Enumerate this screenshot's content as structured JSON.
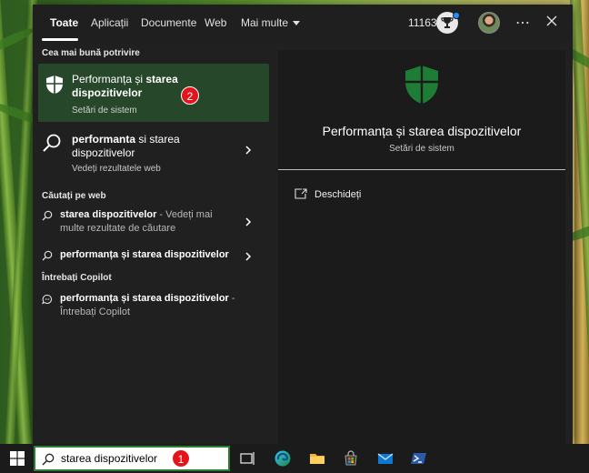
{
  "tabs": [
    {
      "label": "Toate"
    },
    {
      "label": "Aplicații"
    },
    {
      "label": "Documente"
    },
    {
      "label": "Web"
    },
    {
      "label": "Mai multe"
    }
  ],
  "topbar": {
    "points": "11163"
  },
  "left": {
    "best_match_header": "Cea mai bună potrivire",
    "best_match": {
      "title_a": "Performanța și ",
      "title_b": "starea dispozitivelor",
      "subtitle": "Setări de sistem",
      "badge": "2"
    },
    "web_result": {
      "title_a": "performanta",
      "title_b": " si starea dispozitivelor",
      "subtitle": "Vedeți rezultatele web"
    },
    "web_header": "Căutați pe web",
    "web_items": [
      {
        "bold": "starea dispozitivelor",
        "rest": " - Vedeți mai multe rezultate de căutare"
      },
      {
        "bold": "performanța și starea dispozitivelor",
        "rest": ""
      }
    ],
    "copilot_header": "Întrebați Copilot",
    "copilot_item": {
      "bold": "performanța și starea dispozitivelor",
      "rest": " - Întrebați Copilot"
    }
  },
  "right": {
    "title": "Performanța și starea dispozitivelor",
    "subtitle": "Setări de sistem",
    "open_label": "Deschideți"
  },
  "taskbar": {
    "search_value": "starea dispozitivelor",
    "badge": "1",
    "icons": [
      "task-view-icon",
      "edge-icon",
      "file-explorer-icon",
      "store-icon",
      "mail-icon",
      "powershell-icon"
    ]
  },
  "colors": {
    "panel": "#202020",
    "highlight": "#27472b",
    "shield": "#1e7d34",
    "badge": "#e3141b"
  }
}
